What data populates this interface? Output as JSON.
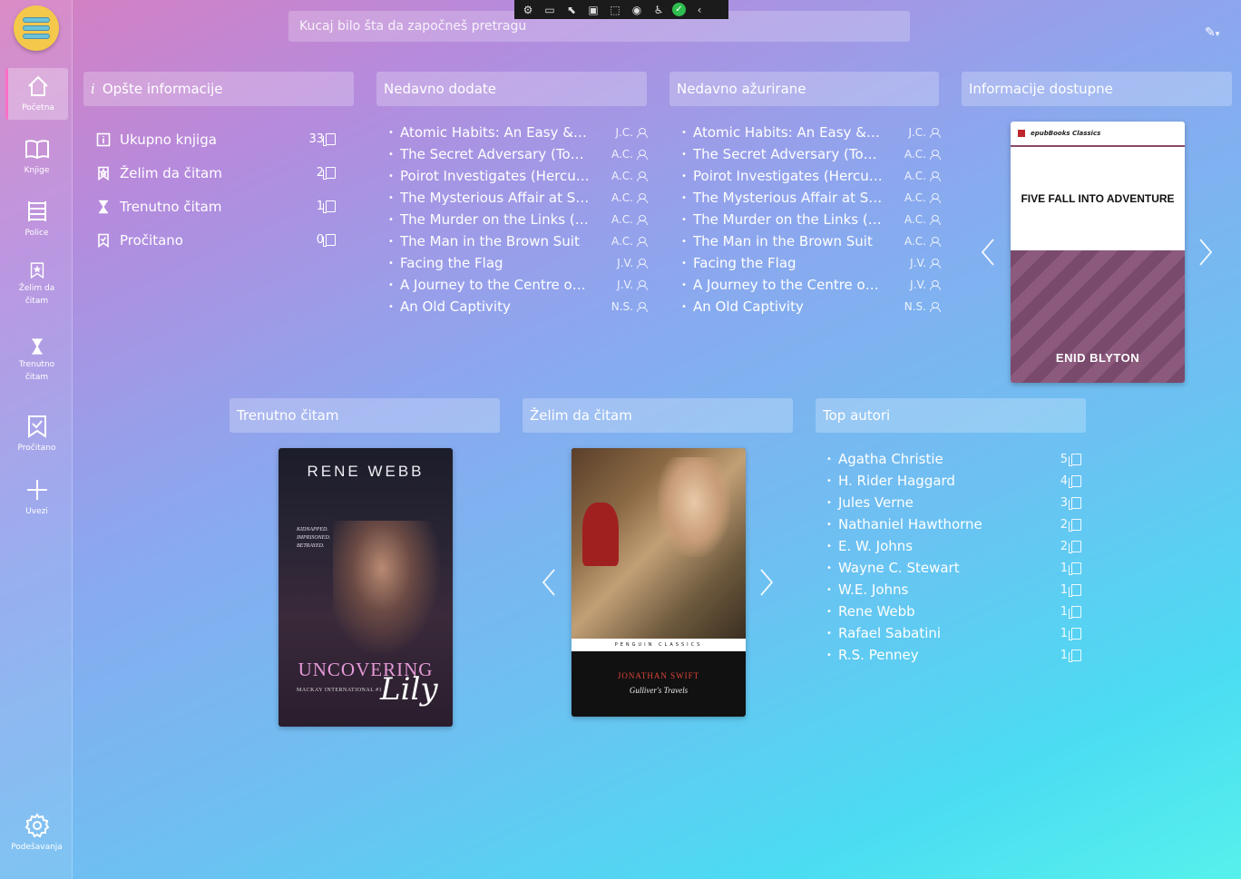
{
  "search": {
    "placeholder": "Kucaj bilo šta da započneš pretragu"
  },
  "sidebar": {
    "items": [
      {
        "label": "Početna",
        "icon": "home-icon"
      },
      {
        "label": "Knjige",
        "icon": "book-open-icon"
      },
      {
        "label": "Police",
        "icon": "shelf-icon"
      },
      {
        "label": "Želim da čitam",
        "icon": "bookmark-star-icon"
      },
      {
        "label": "Trenutno čitam",
        "icon": "hourglass-icon"
      },
      {
        "label": "Pročitano",
        "icon": "bookmark-check-icon"
      },
      {
        "label": "Uvezi",
        "icon": "plus-icon"
      }
    ],
    "settings_label": "Podešavanja"
  },
  "panels": {
    "general": {
      "title": "Opšte informacije",
      "rows": [
        {
          "label": "Ukupno knjiga",
          "count": "33"
        },
        {
          "label": "Želim da čitam",
          "count": "2"
        },
        {
          "label": "Trenutno čitam",
          "count": "1"
        },
        {
          "label": "Pročitano",
          "count": "0"
        }
      ]
    },
    "recently_added": {
      "title": "Nedavno dodate",
      "books": [
        {
          "title": "Atomic Habits: An Easy & P...",
          "author": "J.C."
        },
        {
          "title": "The Secret Adversary (Tom...",
          "author": "A.C."
        },
        {
          "title": "Poirot Investigates (Hercule...",
          "author": "A.C."
        },
        {
          "title": "The Mysterious Affair at Sty...",
          "author": "A.C."
        },
        {
          "title": "The Murder on the Links (H...",
          "author": "A.C."
        },
        {
          "title": "The Man in the Brown Suit",
          "author": "A.C."
        },
        {
          "title": "Facing the Flag",
          "author": "J.V."
        },
        {
          "title": "A Journey to the Centre of ...",
          "author": "J.V."
        },
        {
          "title": "An Old Captivity",
          "author": "N.S."
        }
      ]
    },
    "recently_updated": {
      "title": "Nedavno ažurirane",
      "books": [
        {
          "title": "Atomic Habits: An Easy & P...",
          "author": "J.C."
        },
        {
          "title": "The Secret Adversary (Tom...",
          "author": "A.C."
        },
        {
          "title": "Poirot Investigates (Hercule...",
          "author": "A.C."
        },
        {
          "title": "The Mysterious Affair at Sty...",
          "author": "A.C."
        },
        {
          "title": "The Murder on the Links (H...",
          "author": "A.C."
        },
        {
          "title": "The Man in the Brown Suit",
          "author": "A.C."
        },
        {
          "title": "Facing the Flag",
          "author": "J.V."
        },
        {
          "title": "A Journey to the Centre of ...",
          "author": "J.V."
        },
        {
          "title": "An Old Captivity",
          "author": "N.S."
        }
      ]
    },
    "info_available": {
      "title": "Informacije dostupne",
      "cover": {
        "publisher": "epubBooks Classics",
        "title": "FIVE FALL INTO ADVENTURE",
        "author": "ENID BLYTON"
      }
    },
    "currently_reading": {
      "title": "Trenutno čitam",
      "cover": {
        "author": "RENE WEBB",
        "tagline": "KIDNAPPED. IMPRISONED. BETRAYED.",
        "title_main": "UNCOVERING",
        "title_script": "Lily",
        "series": "MACKAY INTERNATIONAL #1"
      }
    },
    "want_to_read": {
      "title": "Želim da čitam",
      "cover": {
        "imprint": "PENGUIN CLASSICS",
        "author": "JONATHAN SWIFT",
        "title": "Gulliver's Travels"
      }
    },
    "top_authors": {
      "title": "Top autori",
      "authors": [
        {
          "name": "Agatha Christie",
          "count": "5"
        },
        {
          "name": "H. Rider Haggard",
          "count": "4"
        },
        {
          "name": "Jules Verne",
          "count": "3"
        },
        {
          "name": "Nathaniel Hawthorne",
          "count": "2"
        },
        {
          "name": "E. W. Johns",
          "count": "2"
        },
        {
          "name": "Wayne C. Stewart",
          "count": "1"
        },
        {
          "name": "W.E. Johns",
          "count": "1"
        },
        {
          "name": "Rene Webb",
          "count": "1"
        },
        {
          "name": "Rafael Sabatini",
          "count": "1"
        },
        {
          "name": "R.S. Penney",
          "count": "1"
        }
      ]
    }
  },
  "colors": {
    "active_accent": "#ff6ec7",
    "logo_yellow": "#f4c84a",
    "logo_bars": "#6bc3d8"
  }
}
